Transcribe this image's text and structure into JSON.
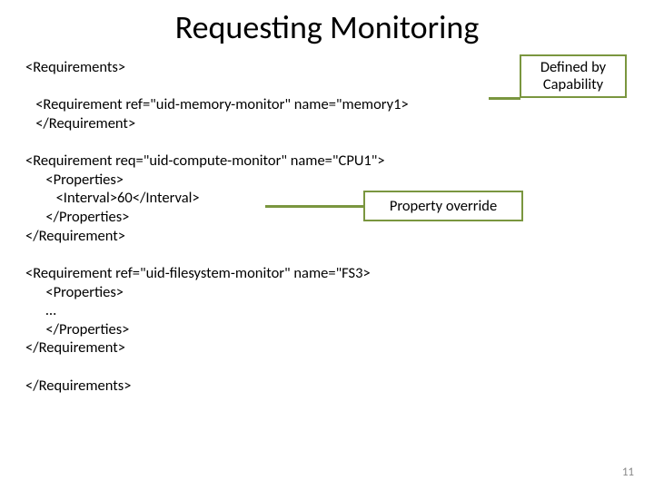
{
  "title": "Requesting Monitoring",
  "code": "<Requirements>\n\n   <Requirement ref=\"uid-memory-monitor\" name=\"memory1>\n   </Requirement>\n\n<Requirement req=\"uid-compute-monitor\" name=\"CPU1\">\n      <Properties>\n         <Interval>60</Interval>\n      </Properties>\n</Requirement>\n\n<Requirement ref=\"uid-filesystem-monitor\" name=\"FS3>\n      <Properties>\n      …\n      </Properties>\n</Requirement>\n\n</Requirements>",
  "callouts": {
    "defined_by": "Defined by\nCapability",
    "override": "Property override"
  },
  "page_number": "11"
}
